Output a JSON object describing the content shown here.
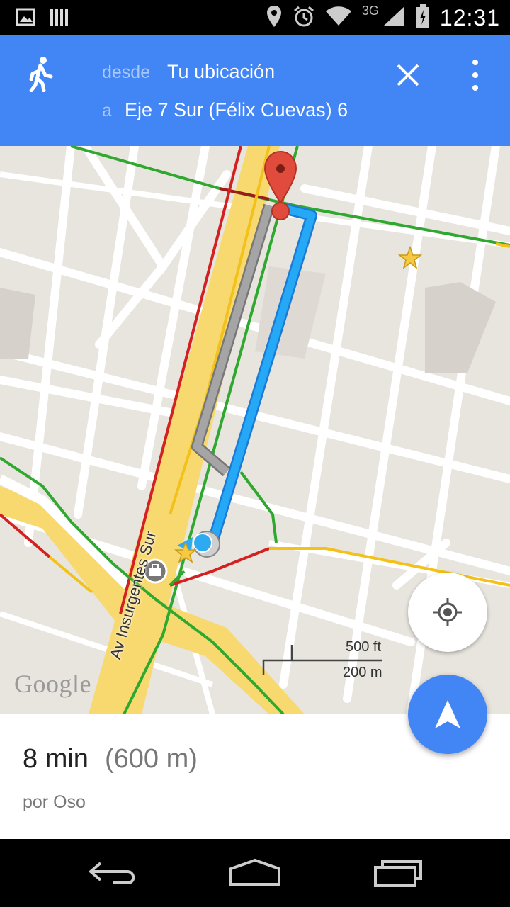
{
  "status_bar": {
    "time": "12:31",
    "network": "3G",
    "icons": [
      "image-icon",
      "barcode-icon",
      "location-icon",
      "alarm-icon",
      "wifi-icon",
      "signal-icon",
      "battery-icon"
    ]
  },
  "header": {
    "mode_icon": "walk-icon",
    "from_label": "desde",
    "from_value": "Tu ubicación",
    "to_label": "a",
    "to_value": "Eje 7 Sur (Félix Cuevas) 6",
    "accent_color": "#4285f4"
  },
  "map": {
    "street_label": "Av Insurgentes Sur",
    "scale_imperial": "500 ft",
    "scale_metric": "200 m",
    "logo": "Google",
    "route_color": "#1e9bf0",
    "alt_route_color": "#9e9e9e"
  },
  "route_summary": {
    "duration": "8 min",
    "distance": "(600 m)",
    "via": "por Oso"
  },
  "system_nav": [
    "back-icon",
    "home-icon",
    "recents-icon"
  ]
}
